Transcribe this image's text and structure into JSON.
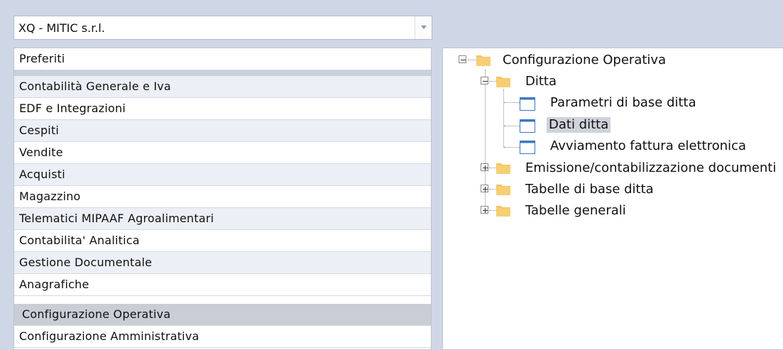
{
  "company_selector": {
    "value": "XQ - MITIC s.r.l."
  },
  "menu": {
    "favorites": "Preferiti",
    "items": [
      "Contabilità Generale e Iva",
      "EDF e Integrazioni",
      "Cespiti",
      "Vendite",
      "Acquisti",
      "Magazzino",
      "Telematici MIPAAF Agroalimentari",
      "Contabilita' Analitica",
      "Gestione Documentale",
      "Anagrafiche",
      "Configurazione Operativa",
      "Configurazione Amministrativa"
    ],
    "active_item": "Configurazione Operativa"
  },
  "tree": {
    "root": "Configurazione Operativa",
    "ditta": "Ditta",
    "ditta_children": [
      "Parametri di base ditta",
      "Dati ditta",
      "Avviamento fattura elettronica"
    ],
    "selected": "Dati ditta",
    "others": [
      "Emissione/contabilizzazione documenti",
      "Tabelle di base ditta",
      "Tabelle generali"
    ]
  },
  "icons": {
    "folder": "folder-icon",
    "window": "window-icon",
    "expand": "plus-box-icon",
    "collapse": "minus-box-icon",
    "dropdown": "chevron-down-icon"
  },
  "colors": {
    "background": "#cfd6e6",
    "folder": "#f3c564",
    "window_title": "#3a78c8",
    "selected": "#cfd3da"
  }
}
